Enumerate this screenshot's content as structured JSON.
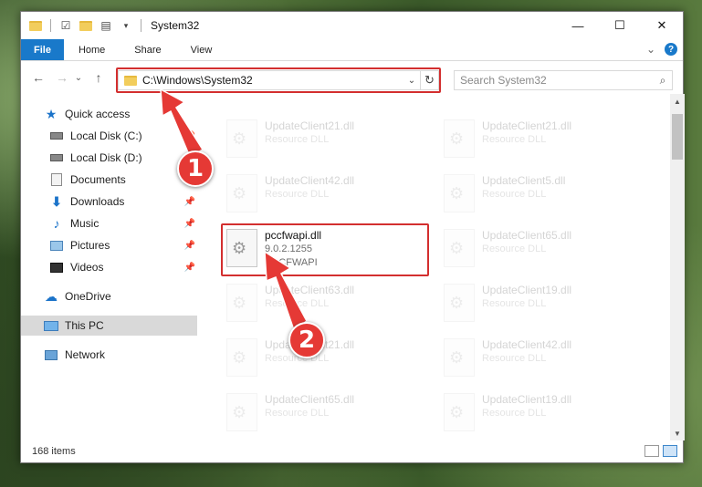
{
  "window": {
    "title": "System32",
    "controls": {
      "minimize": "—",
      "maximize": "☐",
      "close": "✕"
    }
  },
  "ribbon": {
    "tabs": [
      "File",
      "Home",
      "Share",
      "View"
    ],
    "expand": "⌄",
    "help": "?"
  },
  "navbar": {
    "back": "←",
    "forward": "→",
    "recent": "⌄",
    "up": "↑",
    "address": "C:\\Windows\\System32",
    "address_dropdown": "⌄",
    "refresh": "↻",
    "search_placeholder": "Search System32",
    "search_icon": "⌕"
  },
  "sidebar": {
    "items": [
      {
        "label": "Quick access",
        "icon": "star-icon",
        "pinned": false
      },
      {
        "label": "Local Disk (C:)",
        "icon": "disk-icon",
        "pinned": true
      },
      {
        "label": "Local Disk (D:)",
        "icon": "disk-icon",
        "pinned": true
      },
      {
        "label": "Documents",
        "icon": "documents-icon",
        "pinned": true
      },
      {
        "label": "Downloads",
        "icon": "download-icon",
        "pinned": true
      },
      {
        "label": "Music",
        "icon": "music-icon",
        "pinned": true
      },
      {
        "label": "Pictures",
        "icon": "pictures-icon",
        "pinned": true
      },
      {
        "label": "Videos",
        "icon": "videos-icon",
        "pinned": true
      },
      {
        "label": "OneDrive",
        "icon": "cloud-icon",
        "pinned": false
      },
      {
        "label": "This PC",
        "icon": "computer-icon",
        "pinned": false
      },
      {
        "label": "Network",
        "icon": "network-icon",
        "pinned": false
      }
    ]
  },
  "files": {
    "left": [
      {
        "name": "UpdateClient21.dll",
        "sub1": "Resource DLL",
        "sub2": ""
      },
      {
        "name": "UpdateClient42.dll",
        "sub1": "Resource DLL",
        "sub2": ""
      },
      {
        "name": "pccfwapi.dll",
        "sub1": "9.0.2.1255",
        "sub2": "PCCFWAPI"
      },
      {
        "name": "UpdateClient63.dll",
        "sub1": "Resource DLL",
        "sub2": ""
      },
      {
        "name": "UpdateClient21.dll",
        "sub1": "Resource DLL",
        "sub2": ""
      },
      {
        "name": "UpdateClient65.dll",
        "sub1": "Resource DLL",
        "sub2": ""
      }
    ],
    "right": [
      {
        "name": "UpdateClient21.dll",
        "sub1": "Resource DLL"
      },
      {
        "name": "UpdateClient5.dll",
        "sub1": "Resource DLL"
      },
      {
        "name": "UpdateClient65.dll",
        "sub1": "Resource DLL"
      },
      {
        "name": "UpdateClient19.dll",
        "sub1": "Resource DLL"
      },
      {
        "name": "UpdateClient42.dll",
        "sub1": "Resource DLL"
      },
      {
        "name": "UpdateClient19.dll",
        "sub1": "Resource DLL"
      }
    ]
  },
  "status": {
    "count": "168 items"
  },
  "annotations": {
    "step1": "1",
    "step2": "2",
    "color": "#e53935"
  }
}
